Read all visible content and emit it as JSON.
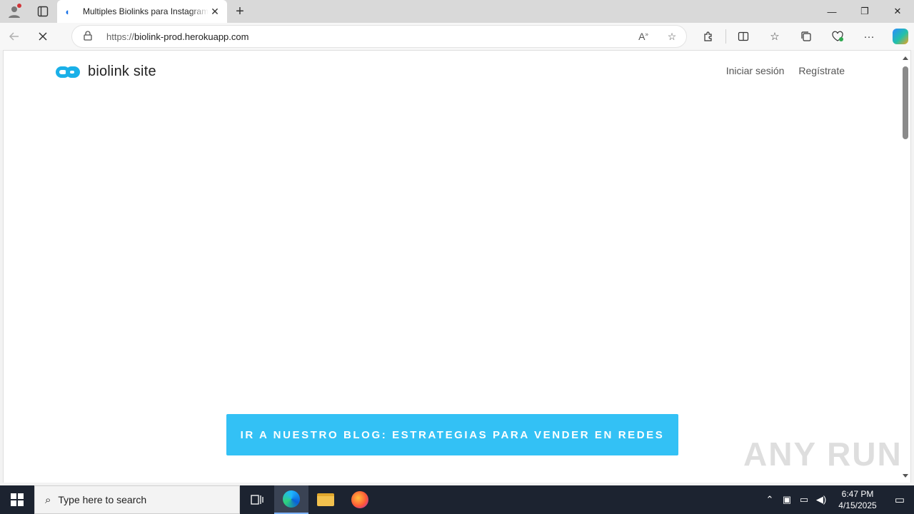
{
  "browser": {
    "tab": {
      "title": "Multiples Biolinks para Instagram"
    },
    "url": {
      "protocol": "https://",
      "host": "biolink-prod.herokuapp.com"
    },
    "window_controls": {
      "minimize": "—",
      "restore": "❐",
      "close": "✕"
    }
  },
  "page": {
    "logo_text": "biolink site",
    "nav": {
      "login": "Iniciar sesión",
      "register": "Regístrate"
    },
    "cta_label": "IR A NUESTRO BLOG: ESTRATEGIAS PARA VENDER EN REDES",
    "watermark": "ANY RUN"
  },
  "taskbar": {
    "search_placeholder": "Type here to search",
    "time": "6:47 PM",
    "date": "4/15/2025"
  },
  "colors": {
    "brand": "#1ab0e8",
    "cta_background": "#33c1f5",
    "taskbar": "#1c2330"
  }
}
